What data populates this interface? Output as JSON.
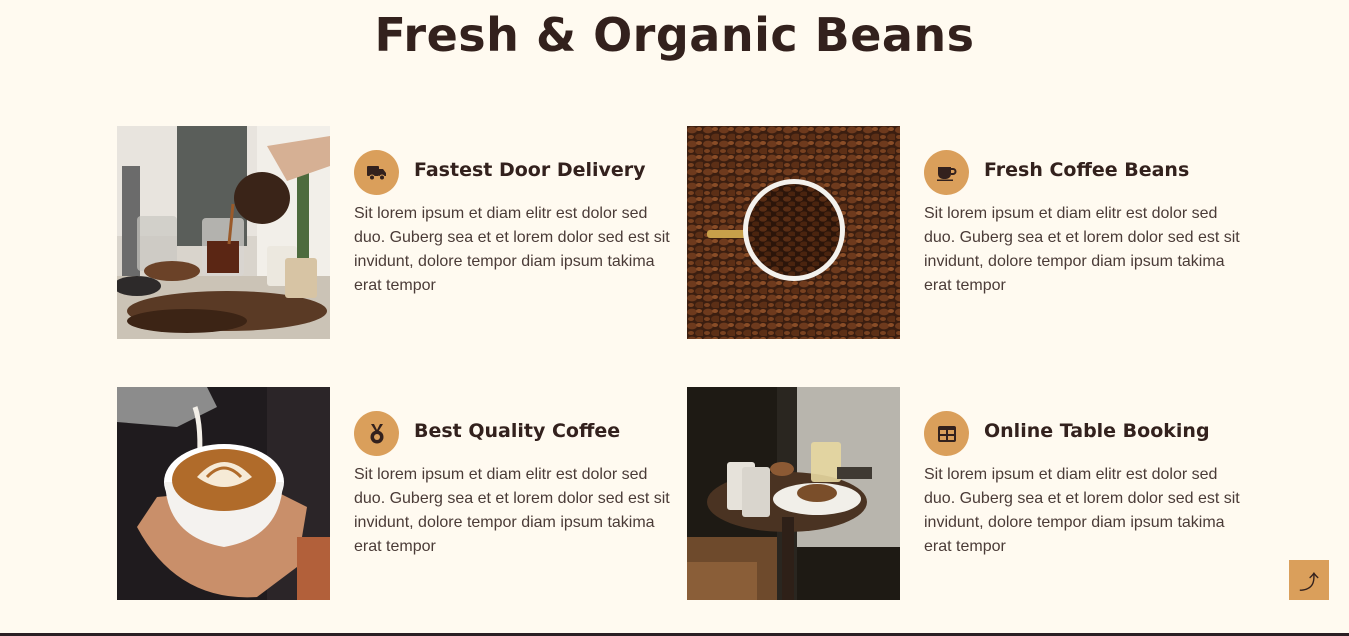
{
  "section": {
    "title": "Fresh & Organic Beans"
  },
  "features": [
    {
      "title": "Fastest Door Delivery",
      "icon": "truck-icon",
      "text": "Sit lorem ipsum et diam elitr est dolor sed duo. Guberg sea et et lorem dolor sed est sit invidunt, dolore tempor diam ipsum takima erat tempor"
    },
    {
      "title": "Fresh Coffee Beans",
      "icon": "coffee-cup-icon",
      "text": "Sit lorem ipsum et diam elitr est dolor sed duo. Guberg sea et et lorem dolor sed est sit invidunt, dolore tempor diam ipsum takima erat tempor"
    },
    {
      "title": "Best Quality Coffee",
      "icon": "award-medal-icon",
      "text": "Sit lorem ipsum et diam elitr est dolor sed duo. Guberg sea et et lorem dolor sed est sit invidunt, dolore tempor diam ipsum takima erat tempor"
    },
    {
      "title": "Online Table Booking",
      "icon": "table-icon",
      "text": "Sit lorem ipsum et diam elitr est dolor sed duo. Guberg sea et et lorem dolor sed est sit invidunt, dolore tempor diam ipsum takima erat tempor"
    }
  ],
  "back_to_top": {
    "icon": "arrow-up-icon",
    "glyph": "⤴"
  },
  "colors": {
    "background": "#fffaf0",
    "accent": "#da9f5b",
    "heading": "#33211d",
    "body_text": "#4a3b37"
  }
}
